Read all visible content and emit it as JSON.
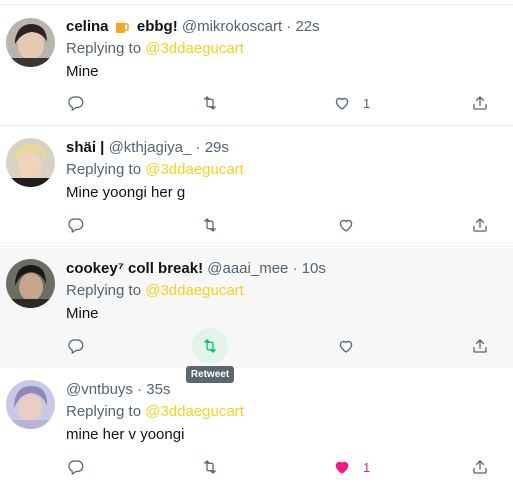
{
  "tweets": [
    {
      "name": "celina",
      "name_suffix": "ebbg!",
      "handle": "@mikrokoscart",
      "separator": "·",
      "time": "22s",
      "replying_prefix": "Replying to",
      "replying_to": "@3ddaegucart",
      "text": "Mine",
      "like_count": "1",
      "liked": false
    },
    {
      "name": "shäi |",
      "handle": "@kthjagiya_",
      "separator": "·",
      "time": "29s",
      "replying_prefix": "Replying to",
      "replying_to": "@3ddaegucart",
      "text": "Mine yoongi her g",
      "like_count": "",
      "liked": false
    },
    {
      "name": "cookey⁷ coll break!",
      "handle": "@aaai_mee",
      "separator": "·",
      "time": "10s",
      "replying_prefix": "Replying to",
      "replying_to": "@3ddaegucart",
      "text": "Mine",
      "like_count": "",
      "liked": false
    },
    {
      "name": "",
      "handle": "@vntbuys",
      "separator": "·",
      "time": "35s",
      "replying_prefix": "Replying to",
      "replying_to": "@3ddaegucart",
      "text": "mine her v yoongi",
      "like_count": "1",
      "liked": true
    }
  ],
  "tooltip": {
    "label": "Retweet"
  },
  "icons": {
    "reply": "reply-icon",
    "retweet": "retweet-icon",
    "like": "heart-icon",
    "share": "share-icon",
    "emoji": "beer-mug-emoji"
  },
  "colors": {
    "mention": "#f4d21f",
    "muted": "#536471",
    "retweet_hover": "#00ba7c",
    "like_active": "#f91880",
    "hover_bg": "#f7f7f7"
  }
}
